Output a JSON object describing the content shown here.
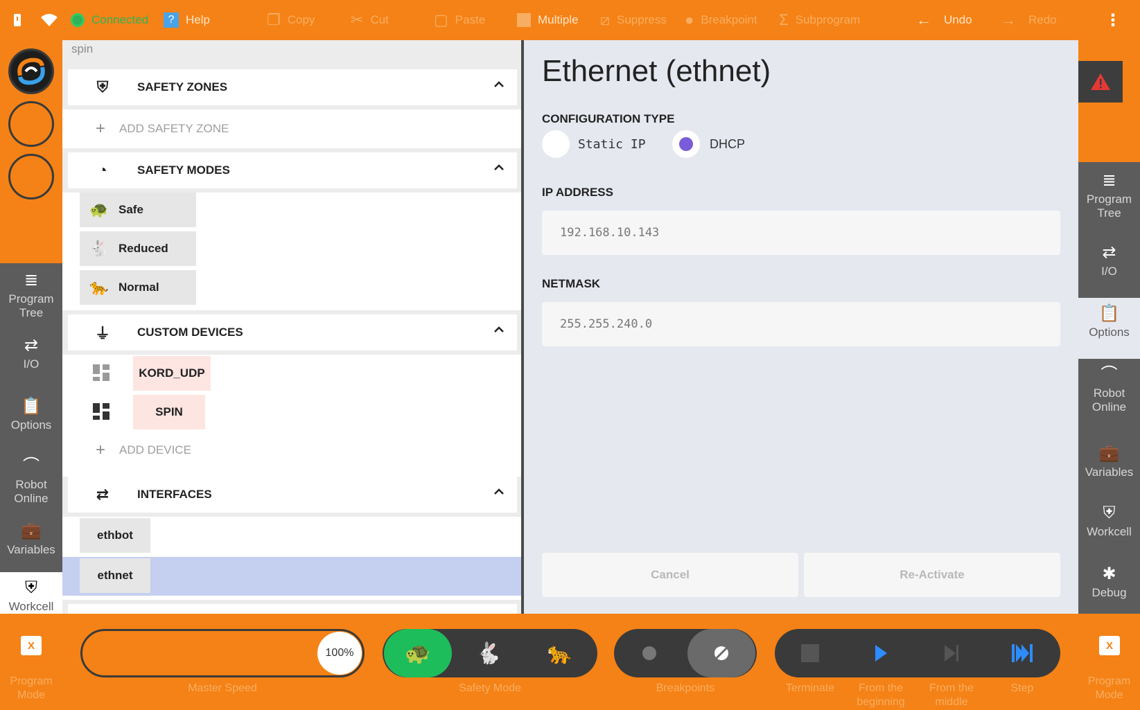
{
  "colors": {
    "accent": "#f58216",
    "dark": "#3a3a3a",
    "connected": "#2fb25a",
    "radio_selected": "#7a5bd9",
    "safe_mode_active": "#1ebd5c",
    "step_blue": "#2d8cff",
    "selection": "#c5cff0"
  },
  "topbar": {
    "connection_status": "Connected",
    "help_label": "Help",
    "copy_label": "Copy",
    "cut_label": "Cut",
    "paste_label": "Paste",
    "multiple_label": "Multiple",
    "suppress_label": "Suppress",
    "breakpoint_label": "Breakpoint",
    "subprogram_label": "Subprogram",
    "undo_label": "Undo",
    "redo_label": "Redo"
  },
  "left_nav": {
    "items": [
      {
        "label": "Program Tree",
        "icon": "list-icon"
      },
      {
        "label": "I/O",
        "icon": "arrows-icon"
      },
      {
        "label": "Options",
        "icon": "clipboard-icon"
      },
      {
        "label": "Robot Online",
        "icon": "robot-arm-icon"
      },
      {
        "label": "Variables",
        "icon": "briefcase-icon"
      },
      {
        "label": "Workcell",
        "icon": "shield-icon",
        "selected": true
      }
    ]
  },
  "right_nav": {
    "items": [
      {
        "label": "Program Tree",
        "icon": "list-icon"
      },
      {
        "label": "I/O",
        "icon": "arrows-icon"
      },
      {
        "label": "Options",
        "icon": "clipboard-icon",
        "selected": true
      },
      {
        "label": "Robot Online",
        "icon": "robot-arm-icon"
      },
      {
        "label": "Variables",
        "icon": "briefcase-icon"
      },
      {
        "label": "Workcell",
        "icon": "shield-icon"
      },
      {
        "label": "Debug",
        "icon": "bug-icon"
      }
    ]
  },
  "tree": {
    "breadcrumb": "spin",
    "safety_zones": {
      "title": "SAFETY ZONES",
      "add_label": "ADD SAFETY ZONE"
    },
    "safety_modes": {
      "title": "SAFETY MODES",
      "modes": [
        "Safe",
        "Reduced",
        "Normal"
      ]
    },
    "custom_devices": {
      "title": "CUSTOM DEVICES",
      "devices": [
        "KORD_UDP",
        "SPIN"
      ],
      "add_label": "ADD DEVICE"
    },
    "interfaces": {
      "title": "INTERFACES",
      "items": [
        "ethbot",
        "ethnet"
      ],
      "selected": "ethnet"
    }
  },
  "detail": {
    "title": "Ethernet (ethnet)",
    "config_type_label": "CONFIGURATION TYPE",
    "options": [
      "Static IP",
      "DHCP"
    ],
    "selected_option": "DHCP",
    "ip_label": "IP ADDRESS",
    "ip_value": "192.168.10.143",
    "netmask_label": "NETMASK",
    "netmask_value": "255.255.240.0",
    "cancel_label": "Cancel",
    "reactivate_label": "Re-Activate"
  },
  "bottombar": {
    "program_mode_label": "Program Mode",
    "program_mode_button": "X",
    "master_speed_label": "Master Speed",
    "master_speed_value": "100%",
    "safety_mode_label": "Safety Mode",
    "breakpoints_label": "Breakpoints",
    "terminate_label": "Terminate",
    "from_beginning_label": "From the beginning",
    "from_middle_label": "From the middle",
    "step_label": "Step"
  }
}
